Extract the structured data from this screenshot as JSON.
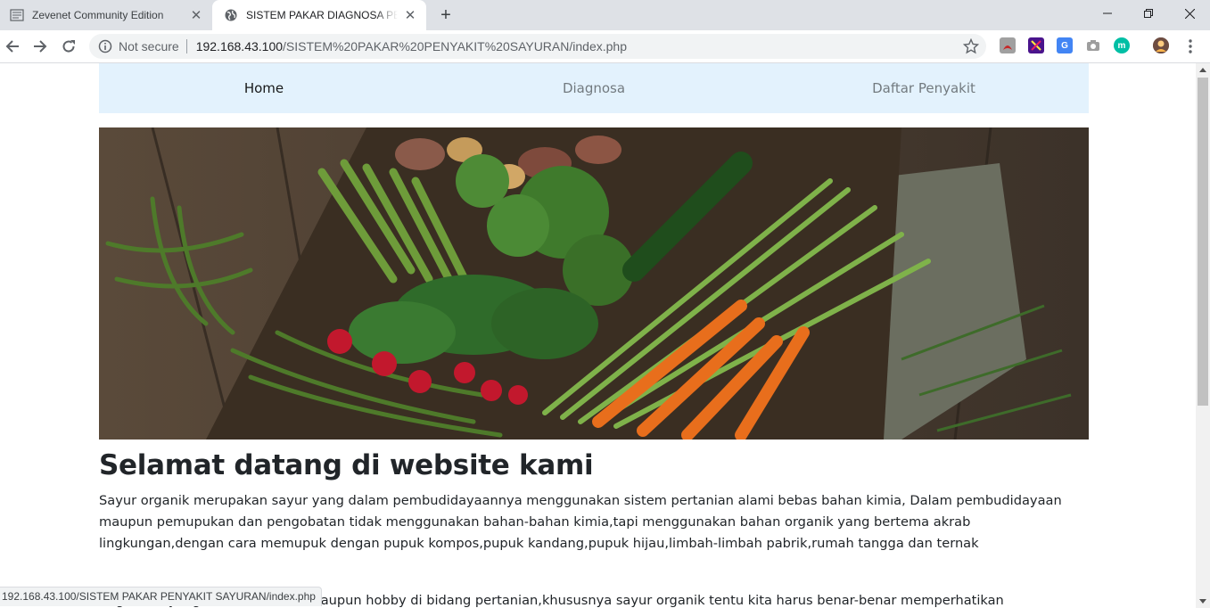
{
  "browser": {
    "tabs": [
      {
        "title": "Zevenet Community Edition",
        "active": false,
        "icon": "document-list-icon"
      },
      {
        "title": "SISTEM PAKAR DIAGNOSA PENYAKIT SAYURAN",
        "active": true,
        "icon": "globe-icon"
      }
    ],
    "security_label": "Not secure",
    "url_host": "192.168.43.100",
    "url_path": "/SISTEM%20PAKAR%20PENYAKIT%20SAYURAN/index.php",
    "status_url": "192.168.43.100/SISTEM PAKAR PENYAKIT SAYURAN/index.php"
  },
  "nav": {
    "items": [
      {
        "label": "Home",
        "active": true
      },
      {
        "label": "Diagnosa",
        "active": false
      },
      {
        "label": "Daftar Penyakit",
        "active": false
      }
    ],
    "bg_color": "#e3f2fd"
  },
  "main": {
    "heading": "Selamat datang di website kami",
    "paragraph1": "Sayur organik merupakan sayur yang dalam pembudidayaannya menggunakan sistem pertanian alami bebas bahan kimia, Dalam pembudidayaan maupun pemupukan dan pengobatan tidak menggunakan bahan-bahan kimia,tapi menggunakan bahan organik yang bertema akrab lingkungan,dengan cara memupuk dengan pupuk kompos,pupuk kandang,pupuk hijau,limbah-limbah pabrik,rumah tangga dan ternak",
    "paragraph2": "Bagi anda yang memiliki usaha ataupun hobby di bidang pertanian,khususnya sayur organik tentu kita harus benar-benar memperhatikan"
  }
}
